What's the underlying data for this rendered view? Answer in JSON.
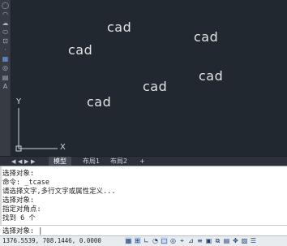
{
  "canvas": {
    "texts": [
      "cad",
      "cad",
      "cad",
      "cad",
      "cad",
      "cad",
      "cad"
    ],
    "ucs": {
      "x_label": "X",
      "y_label": "Y"
    }
  },
  "tabs": {
    "items": [
      {
        "label": "模型",
        "active": true
      },
      {
        "label": "布局1",
        "active": false
      },
      {
        "label": "布局2",
        "active": false
      }
    ],
    "add_label": "+"
  },
  "command": {
    "history": [
      "选择对象:",
      "命令: _tcase",
      "请选择文字,多行文字或属性定义...",
      "选择对象:",
      "指定对角点:",
      "找到 6 个"
    ],
    "prompt": "选择对象: |"
  },
  "status": {
    "coordinates": "1376.5539, 708.1446, 0.0000"
  },
  "colors": {
    "canvas_bg": "#212830",
    "toolbar_bg": "#363b44",
    "active_tab": "#434a55",
    "cad_text": "#e3e3e3"
  }
}
